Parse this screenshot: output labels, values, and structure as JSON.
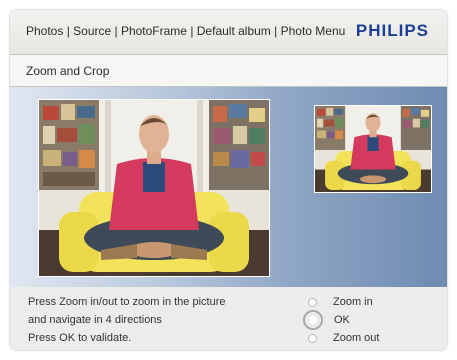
{
  "header": {
    "breadcrumb": "Photos | Source | PhotoFrame | Default album | Photo Menu",
    "brand": "PHILIPS",
    "page_title": "Zoom and Crop"
  },
  "instructions": [
    "Press Zoom in/out to zoom in the picture",
    "and navigate in 4 directions",
    "Press OK to validate."
  ],
  "options": [
    {
      "label": "Zoom in",
      "selected": false
    },
    {
      "label": "OK",
      "selected": true
    },
    {
      "label": "Zoom out",
      "selected": false
    }
  ],
  "colors": {
    "brand": "#1c3f93",
    "jacket": "#d33a5d",
    "chair": "#f2e35b"
  }
}
